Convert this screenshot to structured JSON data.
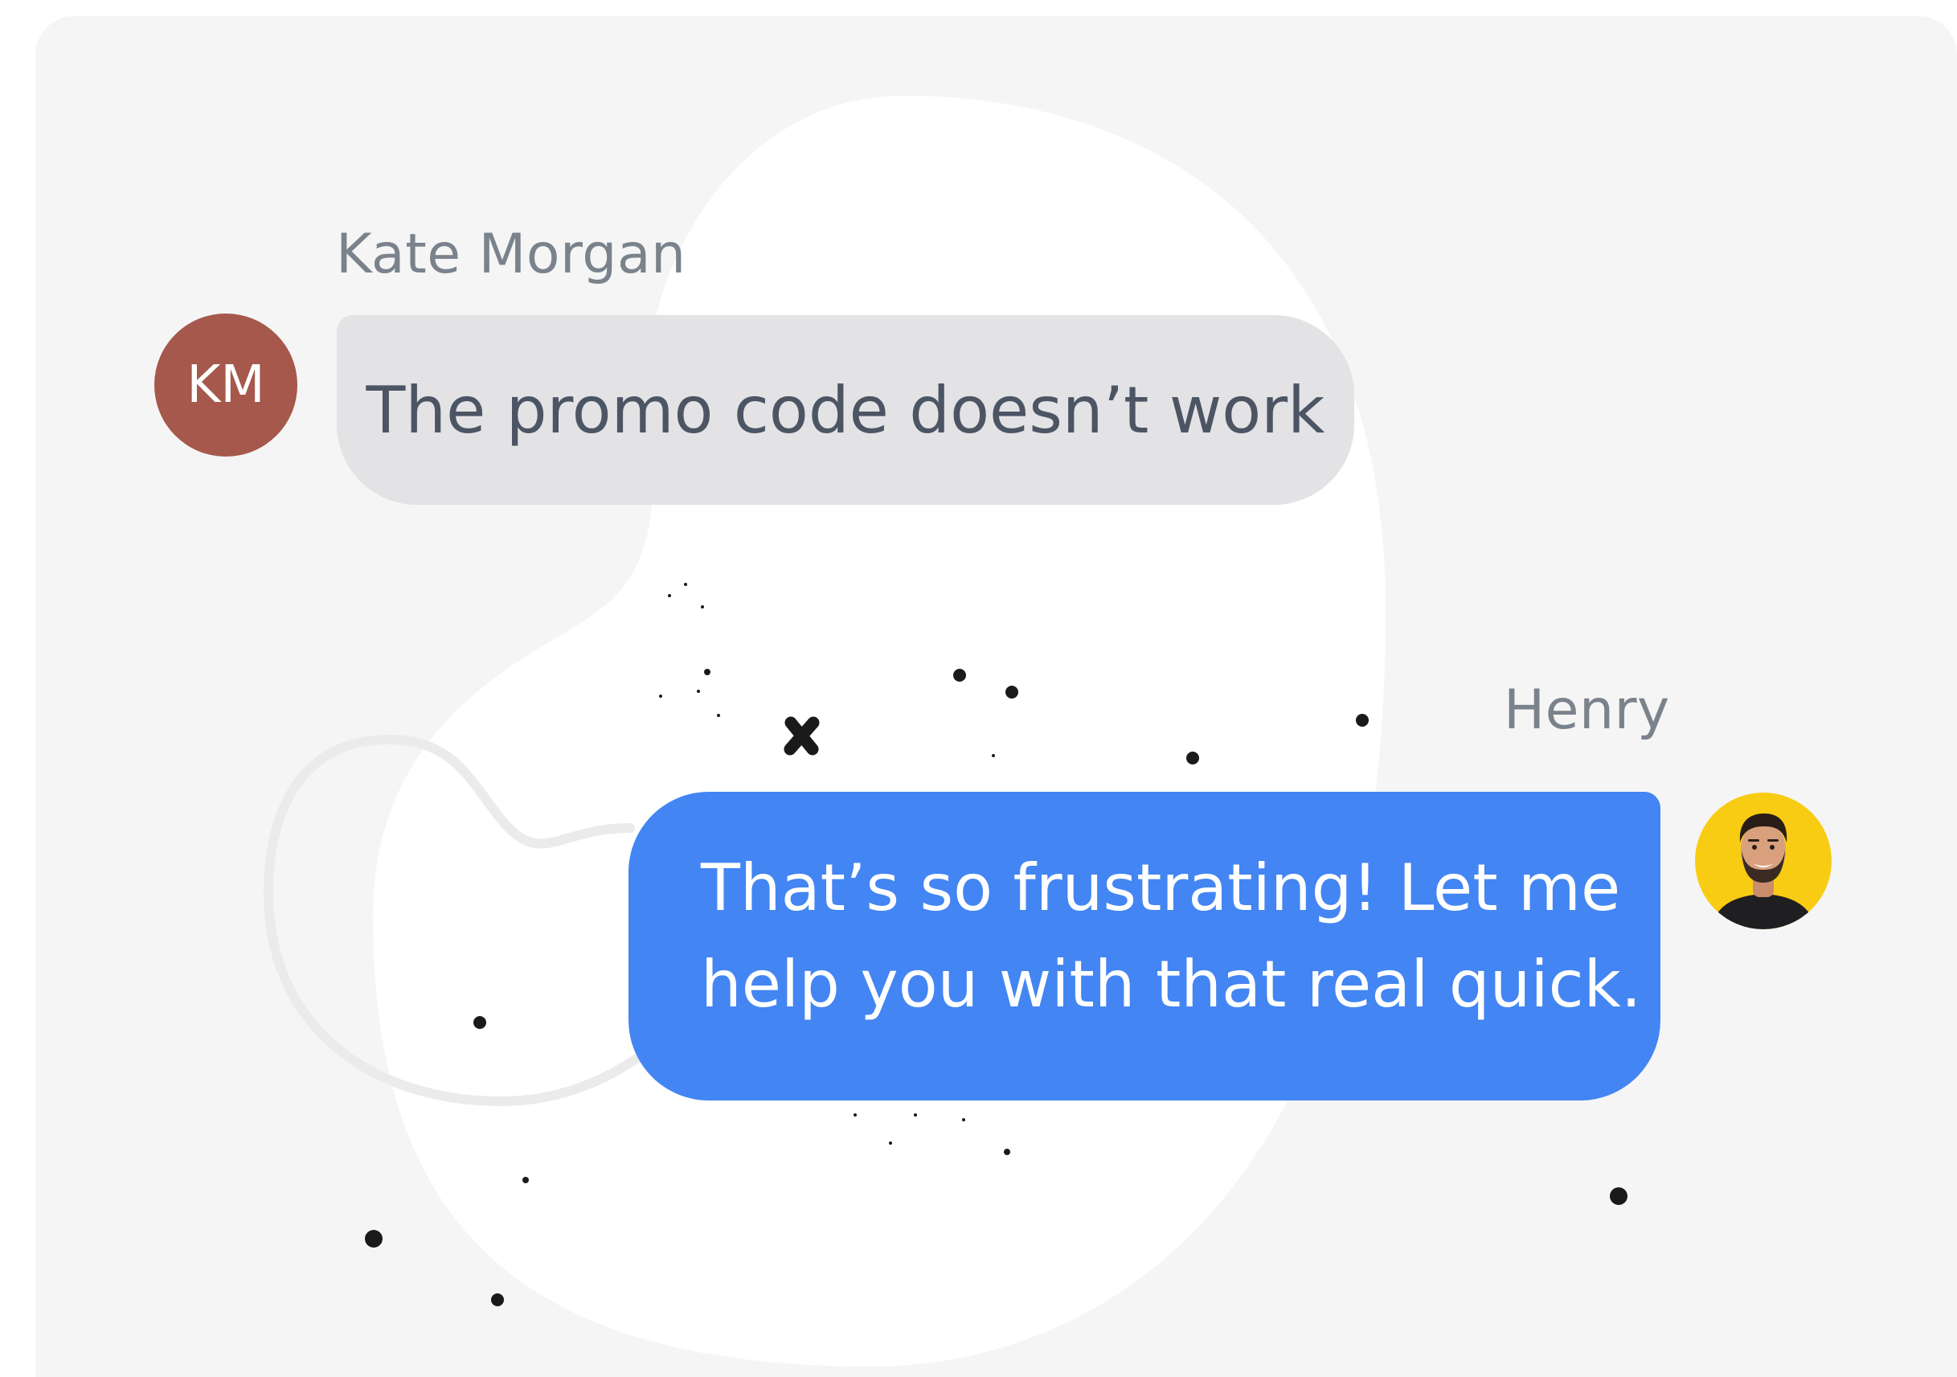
{
  "conversation": {
    "customer": {
      "name": "Kate Morgan",
      "initials": "KM",
      "avatar_color": "#a5584b",
      "message": "The promo code doesn’t work"
    },
    "agent": {
      "name": "Henry",
      "avatar_color": "#f8cc12",
      "message_lines": [
        "That’s so frustrating! Let me",
        "help you with that real quick."
      ]
    }
  },
  "colors": {
    "background": "#f5f5f5",
    "blob": "#ffffff",
    "incoming_bubble": "#e3e3e5",
    "outgoing_bubble": "#4385f2",
    "name_text": "#7a828c"
  }
}
